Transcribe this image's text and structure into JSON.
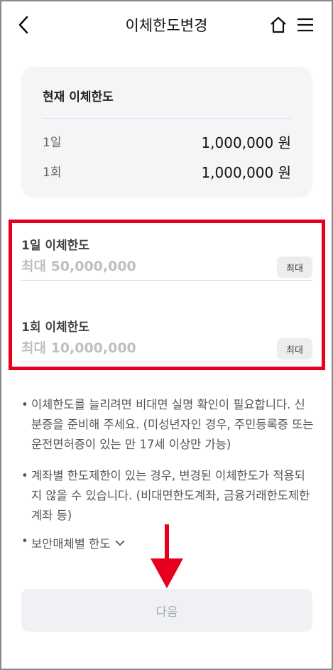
{
  "header": {
    "title": "이체한도변경",
    "back_icon": "chevron-left-icon",
    "home_icon": "home-icon",
    "menu_icon": "hamburger-menu-icon"
  },
  "current_limits": {
    "title": "현재 이체한도",
    "rows": [
      {
        "label": "1일",
        "value": "1,000,000 원"
      },
      {
        "label": "1회",
        "value": "1,000,000 원"
      }
    ]
  },
  "daily_limit": {
    "label": "1일 이체한도",
    "placeholder": "최대 50,000,000",
    "max_button": "최대"
  },
  "per_transfer_limit": {
    "label": "1회 이체한도",
    "placeholder": "최대 10,000,000",
    "max_button": "최대"
  },
  "notes": {
    "bullet": "•",
    "items": [
      "이체한도를 늘리려면 비대면 실명 확인이 필요합니다. 신분증을 준비해 주세요. (미성년자인 경우, 주민등록증 또는 운전면허증이 있는 만 17세 이상만 가능)",
      "계좌별 한도제한이 있는 경우, 변경된 이체한도가 적용되지 않을 수 있습니다. (비대면한도계좌, 금융거래한도제한계좌 등)"
    ],
    "security_toggle": "보안매체별 한도"
  },
  "next_button": {
    "label": "다음"
  },
  "colors": {
    "highlight": "#e6001e",
    "card_bg": "#f4f5f7",
    "button_bg": "#f0f1f4"
  }
}
